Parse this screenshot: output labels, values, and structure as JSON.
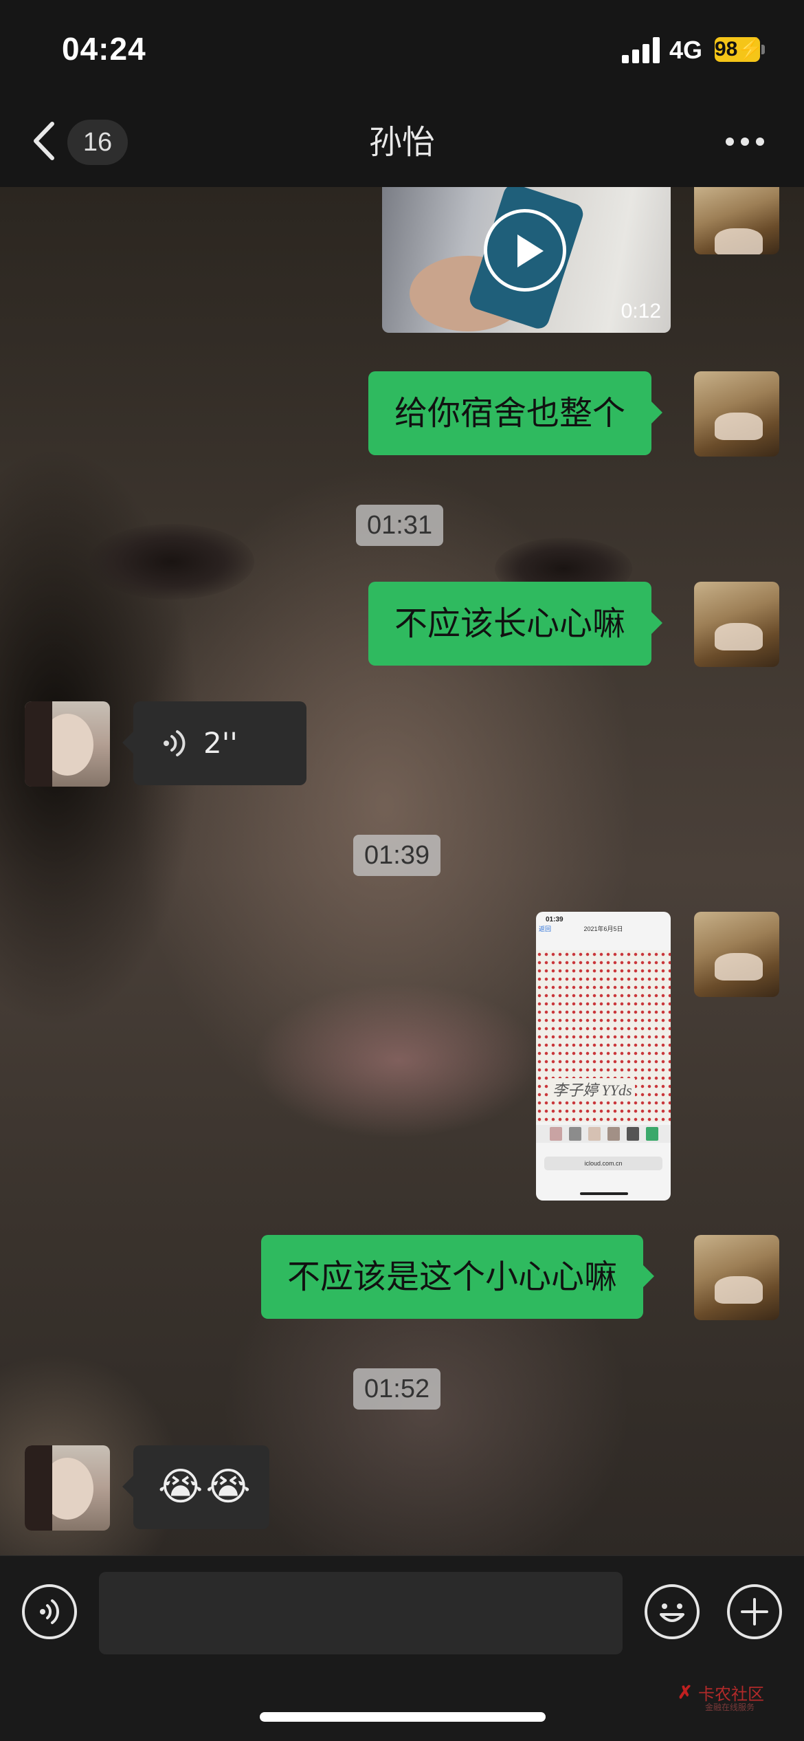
{
  "status_bar": {
    "time": "04:24",
    "network": "4G",
    "battery": "98"
  },
  "nav": {
    "unread_count": "16",
    "title": "孙怡",
    "more_icon": "ellipsis-icon",
    "back_icon": "chevron-left-icon"
  },
  "messages": [
    {
      "type": "video",
      "side": "self",
      "duration": "0:12"
    },
    {
      "type": "text",
      "side": "self",
      "text": "给你宿舍也整个"
    },
    {
      "type": "time",
      "text": "01:31"
    },
    {
      "type": "text",
      "side": "self",
      "text": "不应该长心心嘛"
    },
    {
      "type": "voice",
      "side": "peer",
      "duration": "2''"
    },
    {
      "type": "time",
      "text": "01:39"
    },
    {
      "type": "image",
      "side": "self",
      "content": {
        "clock": "01:39",
        "back_label": "返回",
        "header": "2021年6月5日",
        "handwriting": "李子婷 YYds",
        "url": "icloud.com.cn"
      }
    },
    {
      "type": "text",
      "side": "self",
      "text": "不应该是这个小心心嘛"
    },
    {
      "type": "time",
      "text": "01:52"
    },
    {
      "type": "text",
      "side": "peer",
      "text": "😭😭"
    }
  ],
  "input_bar": {
    "voice_icon": "voice-mode-icon",
    "emoji_icon": "emoji-icon",
    "plus_icon": "plus-icon",
    "placeholder": ""
  },
  "watermark": {
    "title": "卡农社区",
    "subtitle": "金融在线服务"
  },
  "colors": {
    "outgoing_bubble": "#2fba5f",
    "incoming_bubble": "#2c2c2c",
    "battery": "#f5c518",
    "bars_background": "#161616"
  }
}
